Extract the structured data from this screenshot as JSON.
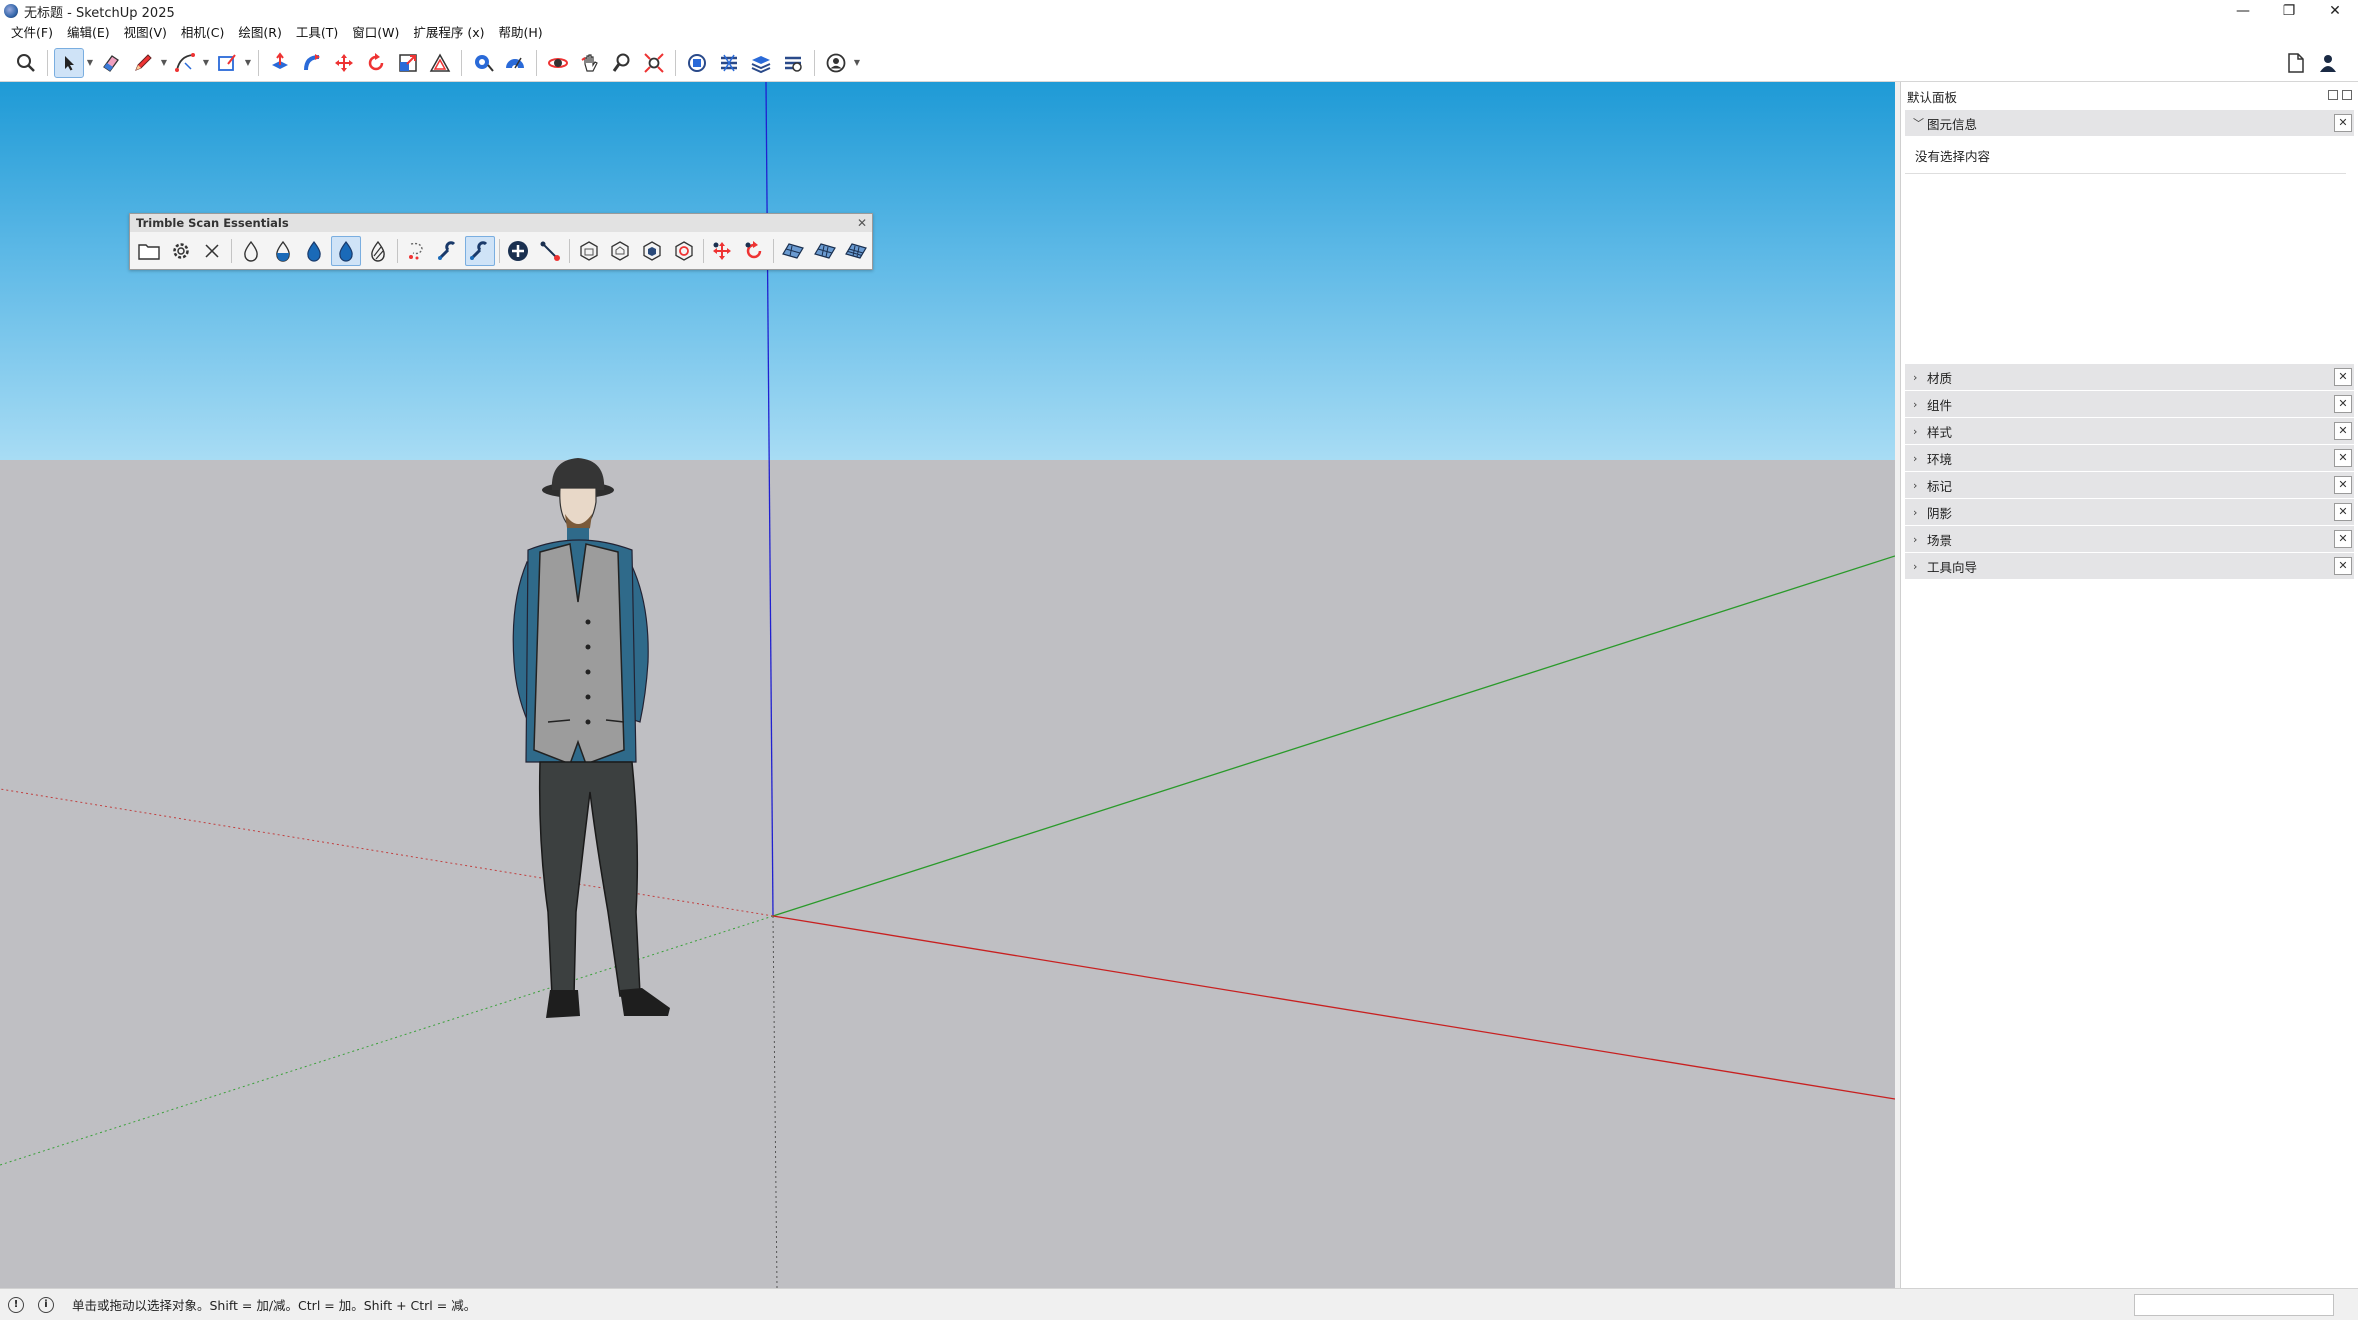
{
  "window": {
    "title": "无标题 - SketchUp 2025",
    "minimize_glyph": "—",
    "restore_glyph": "❐",
    "close_glyph": "✕"
  },
  "menu": [
    "文件(F)",
    "编辑(E)",
    "视图(V)",
    "相机(C)",
    "绘图(R)",
    "工具(T)",
    "窗口(W)",
    "扩展程序 (x)",
    "帮助(H)"
  ],
  "toolbar": {
    "groups": [
      [
        "search-icon"
      ],
      [
        "select-arrow-icon",
        "eraser-icon",
        "pencil-line-icon",
        "arc-icon",
        "rectangle-icon"
      ],
      [
        "push-pull-icon",
        "follow-me-icon",
        "move-icon",
        "rotate-icon",
        "scale-icon",
        "offset-icon"
      ],
      [
        "tape-measure-icon",
        "protractor-icon"
      ],
      [
        "orbit-icon",
        "pan-icon",
        "zoom-icon",
        "zoom-extents-icon"
      ],
      [
        "3d-warehouse-icon",
        "extension-warehouse-icon",
        "layout-icon",
        "extension-manager-icon"
      ],
      [
        "account-icon"
      ]
    ],
    "right_icons": [
      "new-document-icon",
      "user-profile-icon"
    ]
  },
  "floating_toolbar": {
    "title": "Trimble Scan Essentials",
    "close_glyph": "✕",
    "groups": [
      [
        "open-folder-icon",
        "settings-gear-icon",
        "close-x-icon"
      ],
      [
        "drop-outline-icon",
        "drop-half-icon",
        "drop-filled-icon",
        "drop-active-icon",
        "drop-striped-icon"
      ],
      [
        "lasso-icon",
        "snap-magnet-icon",
        "snap-magnet-active-icon"
      ],
      [
        "add-circle-icon",
        "line-tool-icon"
      ],
      [
        "hex-outline-icon",
        "hex-house-icon",
        "hex-solid-icon",
        "hex-red-icon"
      ],
      [
        "move-red-icon",
        "rotate-red-icon"
      ],
      [
        "mesh-1-icon",
        "mesh-2-icon",
        "mesh-3-icon"
      ]
    ]
  },
  "tray": {
    "title": "默认面板",
    "entity_info": {
      "label": "图元信息",
      "empty_text": "没有选择内容"
    },
    "panels": [
      "材质",
      "组件",
      "样式",
      "环境",
      "标记",
      "阴影",
      "场景",
      "工具向导"
    ],
    "close_glyph": "✕"
  },
  "status": {
    "hint": "单击或拖动以选择对象。Shift = 加/减。Ctrl = 加。Shift + Ctrl = 减。",
    "info_glyph": "ⓘ"
  },
  "colors": {
    "sky_top": "#1e9ad6",
    "sky_bottom": "#a8dcf4",
    "ground": "#bfbfc3",
    "axis_red": "#cc2020",
    "axis_green": "#2aa02a",
    "axis_blue": "#1a1ad0"
  }
}
